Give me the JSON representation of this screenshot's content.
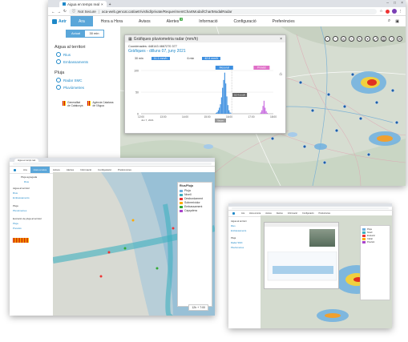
{
  "browser": {
    "tab_title": "Aigua en temps real",
    "url_secure": "Not Secure",
    "url": "aca-web.gencat.cat/aetr/vishid/private/RequerimentChartModal/ChartModalRadar",
    "back": "←",
    "forward": "→",
    "reload": "↻",
    "min": "–",
    "max": "□",
    "close": "×"
  },
  "nav": {
    "logo": "Aetr",
    "items": [
      {
        "label": "Ara",
        "active": true
      },
      {
        "label": "Hora a Hora"
      },
      {
        "label": "Avisos"
      },
      {
        "label": "Alertes",
        "badge": "1"
      },
      {
        "label": "Informació"
      },
      {
        "label": "Configuració"
      },
      {
        "label": "Preferències"
      }
    ]
  },
  "time_toggle": {
    "left": "Actual",
    "right": "30 min"
  },
  "sidebar": {
    "section1": "Aigua al territori",
    "links1": [
      "Rius",
      "Embassaments"
    ],
    "section2": "Pluja",
    "links2": [
      "Radar SMC",
      "Pluviòmetres"
    ],
    "org1_line1": "Generalitat",
    "org1_line2": "de Catalunya",
    "org2_line1": "Agència Catalana",
    "org2_line2": "de l'Aigua"
  },
  "modal": {
    "title": "Gràfiques pluviometria radar (mm/h)",
    "coords": "Coordenades: 448143 4667270 377",
    "subtitle": "Gràfiques - dilluns 07, juny 2021",
    "chip1_label": "30 min",
    "chip1_value": "11.1 mm/h",
    "chip2_label": "6 min",
    "chip2_value": "42.8 mm/h",
    "legend_actual": "Mesurat",
    "legend_pred": "Previst",
    "marker": "16.4 mm/h",
    "footer": "Veure",
    "close": "×"
  },
  "chart_data": {
    "type": "bar",
    "ylim": [
      0,
      100
    ],
    "yticks": [
      "100",
      "50",
      "0"
    ],
    "xticks": [
      "12:00",
      "13:00",
      "14:00",
      "15:00",
      "16:00",
      "17:00",
      "18:00"
    ],
    "xsub": "Jun 7, 2021",
    "series": [
      {
        "name": "Mesurat",
        "color": "#3d8fe0",
        "values": [
          0,
          0,
          0,
          0,
          0,
          0,
          0,
          0,
          0,
          0,
          0,
          0,
          0,
          0,
          0,
          0,
          0,
          0,
          0,
          0,
          0,
          0,
          0,
          0,
          0,
          0,
          0,
          0,
          0,
          0,
          0,
          0,
          0,
          0,
          0,
          0,
          0,
          0,
          0,
          0,
          0,
          0,
          0,
          0,
          0,
          0,
          0,
          0,
          0,
          0,
          0,
          0,
          0,
          0,
          0,
          0,
          0,
          0,
          0,
          0,
          0,
          0,
          0,
          0,
          0,
          0,
          0,
          0,
          0,
          0,
          2,
          4,
          8,
          14,
          22,
          38,
          60,
          78,
          95,
          70,
          40,
          20,
          8,
          3,
          1,
          0,
          0,
          0,
          0,
          0,
          0,
          0,
          0,
          0,
          0,
          0,
          0,
          0,
          0,
          0,
          0,
          0,
          0,
          0,
          0,
          0,
          0,
          0,
          0,
          0,
          0,
          0,
          0,
          0,
          0,
          0,
          0,
          0,
          0,
          0,
          0,
          0,
          0,
          0
        ]
      },
      {
        "name": "Previst",
        "color": "#c86be0",
        "values": [
          0,
          0,
          0,
          0,
          0,
          0,
          0,
          0,
          0,
          0,
          0,
          0,
          0,
          0,
          0,
          0,
          0,
          0,
          0,
          0,
          0,
          0,
          0,
          0,
          0,
          0,
          0,
          0,
          0,
          0,
          0,
          0,
          0,
          0,
          0,
          0,
          0,
          0,
          0,
          0,
          0,
          0,
          0,
          0,
          0,
          0,
          0,
          0,
          0,
          0,
          0,
          0,
          0,
          0,
          0,
          0,
          0,
          0,
          0,
          0,
          0,
          0,
          0,
          0,
          0,
          0,
          0,
          0,
          0,
          0,
          0,
          0,
          0,
          0,
          0,
          0,
          0,
          0,
          0,
          0,
          0,
          0,
          0,
          0,
          0,
          0,
          0,
          0,
          0,
          0,
          0,
          0,
          0,
          0,
          0,
          0,
          0,
          0,
          0,
          0,
          0,
          0,
          0,
          0,
          0,
          0,
          0,
          0,
          0,
          0,
          3,
          8,
          18,
          30,
          14,
          6,
          2,
          0,
          0,
          0,
          0,
          0
        ]
      }
    ]
  },
  "win2": {
    "tab_title": "Aigua en temps real",
    "nav": [
      "Ara",
      "Hora a Hora",
      "Avisos",
      "Alertes",
      "Informació",
      "Configuració",
      "Preferències"
    ],
    "side": [
      "Pluja agregada",
      "Rius",
      "Aigua al territori",
      "Rius",
      "Embassaments",
      "Pluja",
      "Pluviòmetres",
      "Evolució de pluja al territori",
      "Pluja",
      "Previsió"
    ],
    "legend_title": "Rius/Pluja",
    "legend": [
      "Pluja",
      "Nivell",
      "Desbordament",
      "Sobreeixidor",
      "Embassament",
      "Capçalera"
    ],
    "stats": [
      [
        "Màxima",
        ""
      ],
      [
        "Sotmesa",
        ""
      ],
      [
        "Mitjana",
        ""
      ],
      [
        "Mínima",
        ""
      ]
    ],
    "time": "12h + 7:00"
  },
  "win3": {
    "nav": [
      "Ara",
      "Hora a Hora",
      "Avisos",
      "Alertes",
      "Informació",
      "Configuració",
      "Preferències"
    ],
    "side": [
      "Aigua al territori",
      "Rius",
      "Embassaments",
      "Pluja",
      "Radar SMC",
      "Pluviòmetres"
    ],
    "legend": [
      "Pluja",
      "Nivell",
      "Evolució",
      "Cabal",
      "Previsió"
    ]
  }
}
